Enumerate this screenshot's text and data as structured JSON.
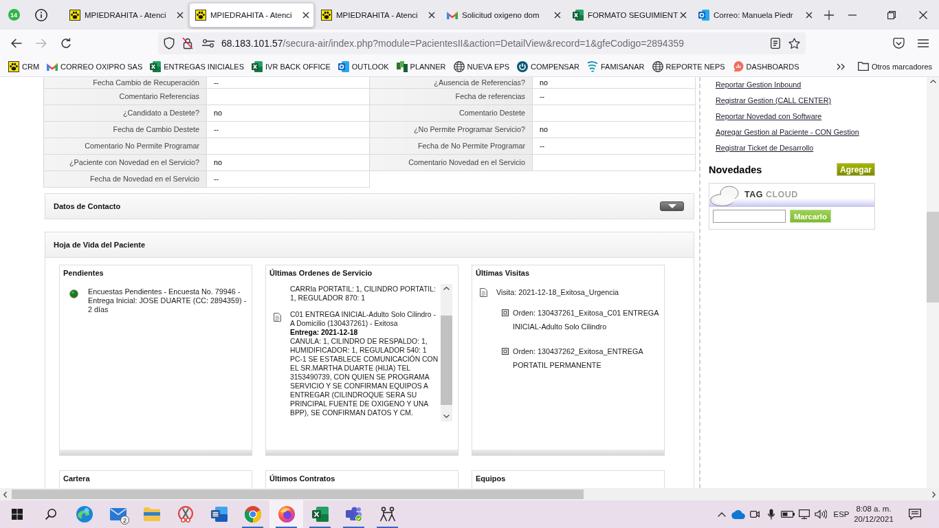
{
  "browser": {
    "pinned_badge": "14",
    "tabs": [
      {
        "title": "MPIEDRAHITA - Atenci",
        "kind": "paw",
        "selected": false
      },
      {
        "title": "MPIEDRAHITA - Atenci",
        "kind": "paw",
        "selected": true
      },
      {
        "title": "MPIEDRAHITA - Atenci",
        "kind": "paw",
        "selected": false
      },
      {
        "title": "Solicitud oxigeno dom",
        "kind": "gmail",
        "selected": false
      },
      {
        "title": "FORMATO SEGUIMIENT",
        "kind": "excel",
        "selected": false
      },
      {
        "title": "Correo: Manuela Piedr",
        "kind": "outlook",
        "selected": false
      }
    ],
    "url": {
      "host": "68.183.101.57",
      "path": "/secura-air/index.php?module=PacientesII&action=DetailView&record=1&gfeCodigo=2894359"
    },
    "bookmarks": [
      {
        "label": "CRM",
        "kind": "paw"
      },
      {
        "label": "CORREO OXIPRO SAS",
        "kind": "gmail"
      },
      {
        "label": "ENTREGAS INICIALES",
        "kind": "excel"
      },
      {
        "label": "IVR BACK OFFICE",
        "kind": "excel"
      },
      {
        "label": "OUTLOOK",
        "kind": "outlook"
      },
      {
        "label": "PLANNER",
        "kind": "planner"
      },
      {
        "label": "NUEVA EPS",
        "kind": "globe"
      },
      {
        "label": "COMPENSAR",
        "kind": "power"
      },
      {
        "label": "FAMISANAR",
        "kind": "swirl"
      },
      {
        "label": "REPORTE NEPS",
        "kind": "globe"
      },
      {
        "label": "DASHBOARDS",
        "kind": "bubble"
      }
    ],
    "other_bookmarks": "Otros marcadores"
  },
  "detail_table": {
    "rows": [
      {
        "fields": [
          {
            "label": "Fecha Cambio de Recuperación",
            "value": "--"
          },
          {
            "label": "¿Ausencia de Referencias?",
            "value": "no"
          }
        ]
      },
      {
        "fields": [
          {
            "label": "Comentario Referencias"
          },
          {
            "label": "Fecha de referencias",
            "value": "--"
          }
        ]
      },
      {
        "fields": [
          {
            "label": "¿Candidato a Destete?",
            "value": "no"
          },
          {
            "label": "Comentario Destete"
          }
        ]
      },
      {
        "fields": [
          {
            "label": "Fecha de Cambio Destete",
            "value": "--"
          },
          {
            "label": "¿No Permite Programar Servicio?",
            "value": "no"
          }
        ]
      },
      {
        "fields": [
          {
            "label": "Comentario No Permite Programar"
          },
          {
            "label": "Fecha de No Permite Programar",
            "value": "--"
          }
        ]
      },
      {
        "fields": [
          {
            "label": "¿Paciente con Novedad en el Servicio?",
            "value": "no"
          },
          {
            "label": "Comentario Novedad en el Servicio"
          }
        ]
      },
      {
        "fields": [
          {
            "label": "Fecha de Novedad en el Servicio",
            "value": "--"
          }
        ]
      }
    ]
  },
  "contact_section": {
    "title": "Datos de Contacto"
  },
  "history_section": {
    "title": "Hoja de Vida del Paciente",
    "cards": [
      {
        "title": "Pendientes",
        "kind": "pending",
        "items": [
          {
            "text": "Encuestas Pendientes - Encuesta No. 79946 - Entrega Inicial: JOSE DUARTE (CC: 2894359) - 2 días"
          }
        ]
      },
      {
        "title": "Últimas Ordenes de Servicio",
        "kind": "orders",
        "items": [
          {
            "detail": "CARRIa PORTATIL: 1, CILINDRO PORTATIL: 1, REGULADOR 870: 1"
          },
          {
            "title": "C01 ENTREGA INICIAL-Adulto Solo Cilindro - A Domicilio (130437261) - Exitosa",
            "delivery": "Entrega: 2021-12-18",
            "detail": "CANULA: 1, CILINDRO DE RESPALDO: 1, HUMIDIFICADOR: 1, REGULADOR 540: 1 PC-1 SE ESTABLECE COMUNICACIÓN CON EL SR.MARTHA DUARTE (HIJA) TEL 3153490739, CON QUIEN SE PROGRAMA SERVICIO Y SE CONFIRMAN EQUIPOS A ENTREGAR (CILINDROQUE SERA SU PRINCIPAL FUENTE DE OXIGENO Y UNA BPP), SE CONFIRMAN DATOS Y CM."
          }
        ]
      },
      {
        "title": "Últimas Visitas",
        "kind": "visits",
        "items": [
          {
            "text": "Visita: 2021-12-18_Exitosa_Urgencia",
            "children": [
              {
                "text": "Orden: 130437261_Exitosa_C01 ENTREGA INICIAL-Adulto Solo Cilindro"
              },
              {
                "text": "Orden: 130437262_Exitosa_ENTREGA PORTATIL PERMANENTE"
              }
            ]
          }
        ]
      },
      {
        "title": "Cartera",
        "kind": "header"
      },
      {
        "title": "Últimos Contratos",
        "kind": "header"
      },
      {
        "title": "Equipos",
        "kind": "header"
      }
    ]
  },
  "sidebar": {
    "links": [
      "Reportar Gestion Inbound",
      "Registrar Gestion (CALL CENTER)",
      "Reportar Novedad con Software",
      "Agregar Gestion al Paciente - CON Gestion",
      "Registrar Ticket de Desarrollo"
    ],
    "news": {
      "title": "Novedades",
      "button": "Agregar"
    },
    "tag_cloud": {
      "heading": [
        "TAG",
        "CLOUD"
      ],
      "button": "Marcarlo"
    }
  },
  "taskbar": {
    "apps": [
      {
        "kind": "edge",
        "running": false,
        "selected": false
      },
      {
        "kind": "mail",
        "badge": "2",
        "running": false,
        "selected": false
      },
      {
        "kind": "explorer",
        "running": false,
        "selected": false
      },
      {
        "kind": "snip",
        "running": false,
        "selected": false
      },
      {
        "kind": "word",
        "running": false,
        "selected": false
      },
      {
        "kind": "chrome",
        "running": true,
        "selected": false
      },
      {
        "kind": "firefox",
        "running": true,
        "selected": true
      },
      {
        "kind": "excel",
        "running": true,
        "selected": false
      },
      {
        "kind": "teams",
        "running": true,
        "selected": false
      },
      {
        "kind": "people",
        "running": true,
        "selected": false
      }
    ],
    "tray": {
      "language": "ESP",
      "time": "8:08 a. m.",
      "date": "20/12/2021"
    }
  }
}
